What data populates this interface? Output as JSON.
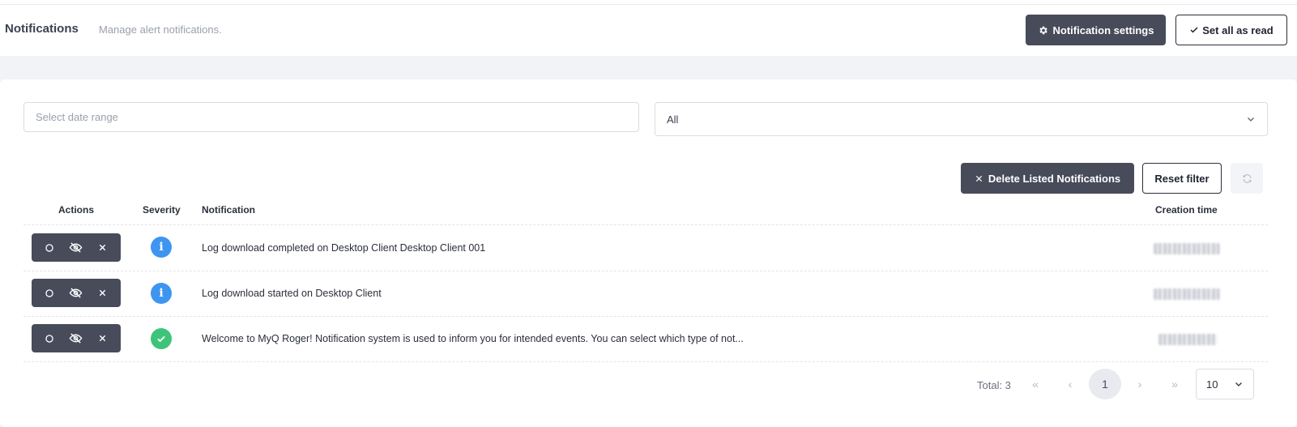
{
  "header": {
    "title": "Notifications",
    "subtitle": "Manage alert notifications.",
    "settings_label": "Notification settings",
    "set_all_read_label": "Set all as read"
  },
  "filters": {
    "date_placeholder": "Select date range",
    "type_selected": "All"
  },
  "toolbar": {
    "delete_label": "Delete Listed Notifications",
    "reset_label": "Reset filter"
  },
  "table": {
    "columns": {
      "actions": "Actions",
      "severity": "Severity",
      "notification": "Notification",
      "creation_time": "Creation time"
    },
    "rows": [
      {
        "severity": "info",
        "icon": "info-icon",
        "text": "Log download completed on Desktop Client Desktop Client 001"
      },
      {
        "severity": "info",
        "icon": "info-icon",
        "text": "Log download started on Desktop Client"
      },
      {
        "severity": "success",
        "icon": "check-icon",
        "text": "Welcome to MyQ Roger! Notification system is used to inform you for intended events. You can select which type of not..."
      }
    ]
  },
  "pagination": {
    "total_label": "Total: 3",
    "current_page": "1",
    "page_size": "10"
  },
  "colors": {
    "dark_button": "#474b5a",
    "info": "#3e95f0",
    "success": "#3ec47a"
  }
}
